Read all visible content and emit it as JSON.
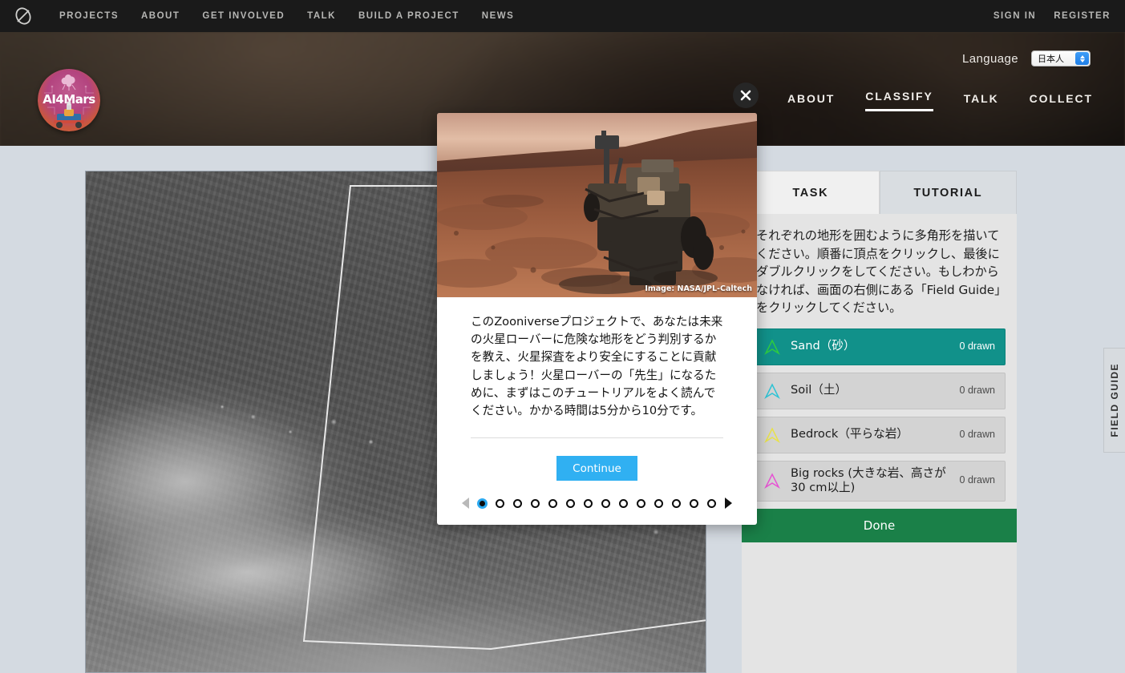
{
  "zooniverse_bar": {
    "logo_icon": "zooniverse-logo-icon",
    "nav": [
      {
        "label": "PROJECTS"
      },
      {
        "label": "ABOUT"
      },
      {
        "label": "GET INVOLVED"
      },
      {
        "label": "TALK"
      },
      {
        "label": "BUILD A PROJECT"
      },
      {
        "label": "NEWS"
      }
    ],
    "sign_in": "SIGN IN",
    "register": "REGISTER"
  },
  "hero": {
    "brand_name": "AI4Mars",
    "language_label": "Language",
    "language_value": "日本人",
    "project_nav": [
      {
        "label": "ABOUT",
        "active": false
      },
      {
        "label": "CLASSIFY",
        "active": true
      },
      {
        "label": "TALK",
        "active": false
      },
      {
        "label": "COLLECT",
        "active": false
      }
    ]
  },
  "panel": {
    "tabs": [
      {
        "label": "TASK",
        "active": true
      },
      {
        "label": "TUTORIAL",
        "active": false
      }
    ],
    "task_text": "それぞれの地形を囲むように多角形を描いてください。順番に頂点をクリックし、最後にダブルクリックをしてください。もしわからなければ、画面の右側にある「Field Guide」をクリックしてください。",
    "tools": [
      {
        "label": "Sand（砂）",
        "count": "0 drawn",
        "color": "#2ecc40",
        "selected": true
      },
      {
        "label": "Soil（土）",
        "count": "0 drawn",
        "color": "#2ec4d6",
        "selected": false
      },
      {
        "label": "Bedrock（平らな岩）",
        "count": "0 drawn",
        "color": "#e9e24a",
        "selected": false
      },
      {
        "label": "Big rocks (大きな岩、高さが 30 cm以上)",
        "count": "0 drawn",
        "color": "#e754d4",
        "selected": false
      }
    ],
    "done_label": "Done",
    "field_guide_label": "FIELD GUIDE"
  },
  "tutorial_modal": {
    "close_icon": "close-icon",
    "media_credit": "Image: NASA/JPL-Caltech",
    "body_text": "このZooniverseプロジェクトで、あなたは未来の火星ローバーに危険な地形をどう判別するかを教え、火星探査をより安全にすることに貢献しましょう！火星ローバーの「先生」になるために、まずはこのチュートリアルをよく読んでください。かかる時間は5分から10分です。",
    "continue_label": "Continue",
    "page_count": 14,
    "current_page": 1,
    "prev_icon": "chevron-left-icon",
    "next_icon": "chevron-right-icon"
  },
  "colors": {
    "accent_blue": "#30b0f2",
    "selected_teal": "#11918a",
    "done_green": "#1a8048",
    "bar_dark": "#1a1a1a",
    "page_bg": "#d4dae1"
  }
}
